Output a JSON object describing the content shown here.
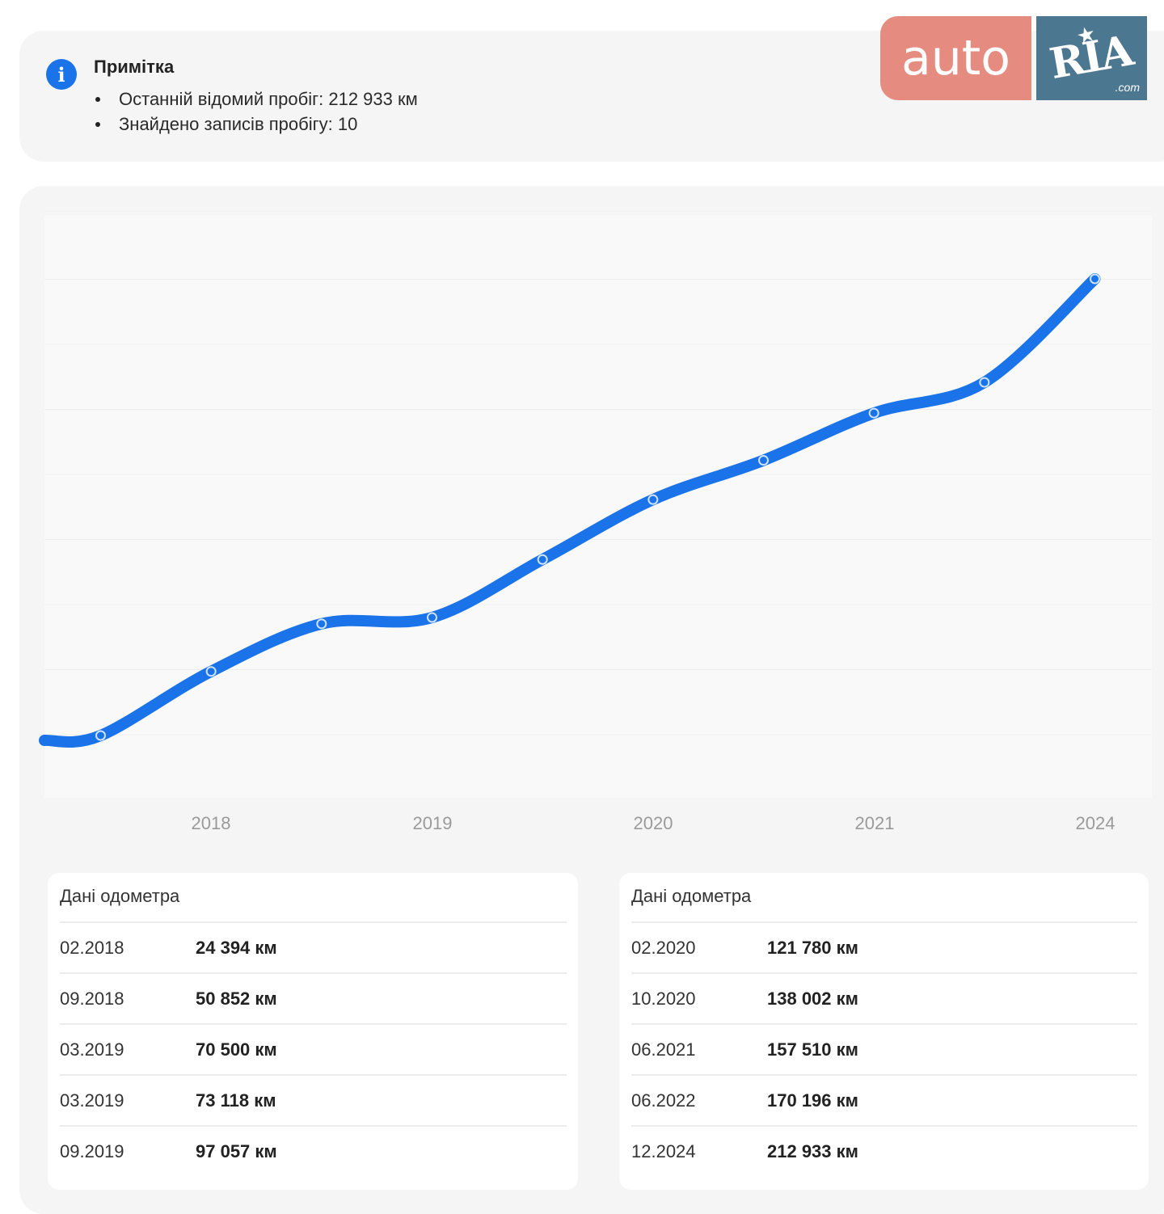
{
  "note": {
    "icon": "info-icon",
    "title": "Примітка",
    "items": [
      "Останній відомий пробіг: 212 933 км",
      "Знайдено записів пробігу: 10"
    ]
  },
  "logo": {
    "auto": "auto",
    "ria": "RIA",
    "com": ".com",
    "colors": {
      "auto_bg": "#e58b80",
      "ria_bg": "#4c7791"
    }
  },
  "chart_data": {
    "type": "line",
    "title": "",
    "xlabel": "",
    "ylabel": "",
    "x_tick_labels": [
      "2018",
      "2019",
      "2020",
      "2021",
      "2024"
    ],
    "series": [
      {
        "values": [
          24394,
          50852,
          70500,
          73118,
          97057,
          121780,
          138002,
          157510,
          170196,
          212933
        ],
        "x": [
          "02.2018",
          "09.2018",
          "03.2019",
          "03.2019",
          "09.2019",
          "02.2020",
          "10.2020",
          "06.2021",
          "06.2022",
          "12.2024"
        ]
      }
    ],
    "grid": true,
    "legend": "none",
    "line_color": "#1a73e8"
  },
  "odometer": {
    "left": {
      "title": "Дані одометра",
      "rows": [
        {
          "date": "02.2018",
          "km": "24 394 км"
        },
        {
          "date": "09.2018",
          "km": "50 852 км"
        },
        {
          "date": "03.2019",
          "km": "70 500 км"
        },
        {
          "date": "03.2019",
          "km": "73 118 км"
        },
        {
          "date": "09.2019",
          "km": "97 057 км"
        }
      ]
    },
    "right": {
      "title": "Дані одометра",
      "rows": [
        {
          "date": "02.2020",
          "km": "121 780 км"
        },
        {
          "date": "10.2020",
          "km": "138 002 км"
        },
        {
          "date": "06.2021",
          "km": "157 510 км"
        },
        {
          "date": "06.2022",
          "km": "170 196 км"
        },
        {
          "date": "12.2024",
          "km": "212 933 км"
        }
      ]
    }
  }
}
